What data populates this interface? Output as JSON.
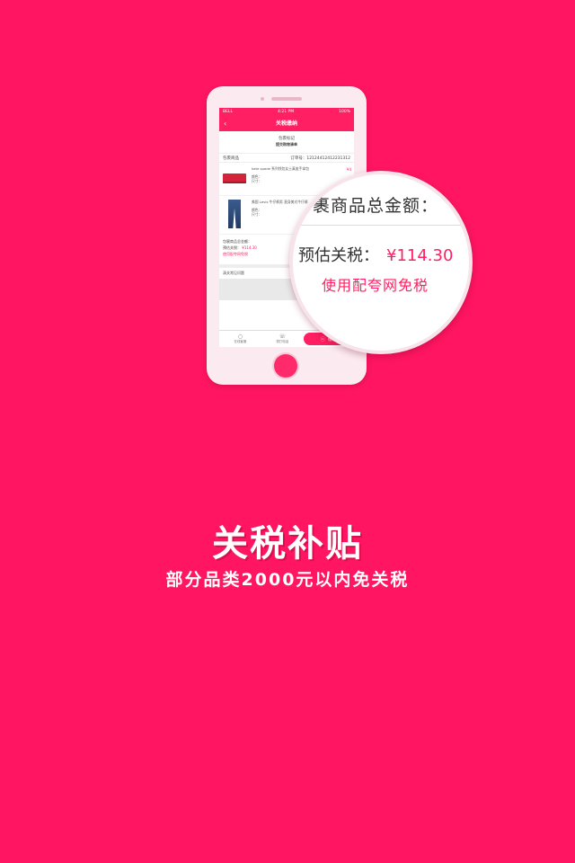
{
  "colors": {
    "background": "#ff1561",
    "accent": "#ff1f62",
    "phone_body": "#fbeaf0"
  },
  "phone": {
    "status": {
      "carrier": "BELL",
      "time": "4:21 PM",
      "battery": "100%"
    },
    "nav": {
      "title": "关税缴纳",
      "back_icon": "chevron-left-icon"
    },
    "package": {
      "name": "包裹标记",
      "sub": "提交购物清单"
    },
    "order": {
      "label": "包裹商品",
      "number": "订单号：12124412412231312"
    },
    "products": [
      {
        "name": "kate spade 系列钱包女士真皮手拿包",
        "attrs": "颜色：\n尺寸：",
        "price": "¥4",
        "image": "red-wallet"
      },
      {
        "name": "美国 Levis 牛仔裤男 直身美式牛仔裤",
        "attrs": "颜色：\n尺寸：",
        "price": "",
        "image": "jeans"
      }
    ],
    "totals": {
      "sum_label": "包裹商品总金额：",
      "tax_label": "预估关税：",
      "tax_amount": "¥114.30",
      "exempt": "使用配夸网免税"
    },
    "faq": {
      "label": "清关常见问题"
    },
    "tabbar": {
      "service": "在线客服",
      "phone": "拨打电话",
      "pay": "缴税"
    }
  },
  "magnifier": {
    "line1": "裹商品总金额：",
    "tax_label": "预估关税：",
    "tax_amount": "¥114.30",
    "exempt": "使用配夸网免税"
  },
  "headline": {
    "title": "关税补贴",
    "subtitle": "部分品类2000元以内免关税"
  }
}
